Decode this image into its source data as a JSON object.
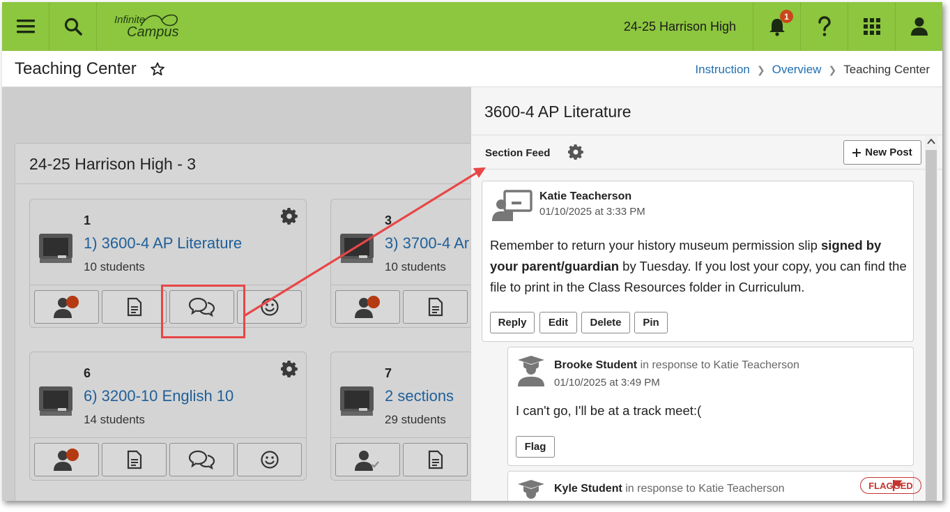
{
  "header": {
    "logo_line1": "Infinite",
    "logo_line2": "Campus",
    "school": "24-25 Harrison High",
    "notification_count": "1"
  },
  "titlebar": {
    "title": "Teaching Center",
    "breadcrumb": [
      "Instruction",
      "Overview",
      "Teaching Center"
    ]
  },
  "panel": {
    "title": "24-25 Harrison High - 3",
    "cards": [
      {
        "num": "1",
        "name": "1) 3600-4 AP Literature",
        "students": "10 students"
      },
      {
        "num": "3",
        "name": "3) 3700-4 Ar",
        "students": "10 students"
      },
      {
        "num": "6",
        "name": "6) 3200-10 English 10",
        "students": "14 students"
      },
      {
        "num": "7",
        "name": "2 sections",
        "students": "29 students"
      }
    ]
  },
  "detail": {
    "title": "3600-4 AP Literature",
    "feed_label": "Section Feed",
    "new_post": "New Post",
    "post": {
      "author": "Katie Teacherson",
      "date": "01/10/2025 at 3:33 PM",
      "body_1": "Remember to return your history museum permission slip ",
      "body_bold": "signed by your parent/guardian",
      "body_2": " by Tuesday. If you lost your copy, you can find the file to print in the Class Resources folder in Curriculum.",
      "actions": [
        "Reply",
        "Edit",
        "Delete",
        "Pin"
      ]
    },
    "replies": [
      {
        "author": "Brooke Student",
        "resp": "in response to Katie Teacherson",
        "date": "01/10/2025 at 3:49 PM",
        "body": "I can't go, I'll be at a track meet:(",
        "action": "Flag"
      },
      {
        "author": "Kyle Student",
        "resp": "in response to Katie Teacherson",
        "status": "FLAGGED"
      }
    ]
  },
  "colors": {
    "brand_green": "#8dc63f",
    "link_blue": "#1f6fb2",
    "badge": "#c9471b",
    "highlight": "#e84646",
    "flag_red": "#c4332f"
  }
}
